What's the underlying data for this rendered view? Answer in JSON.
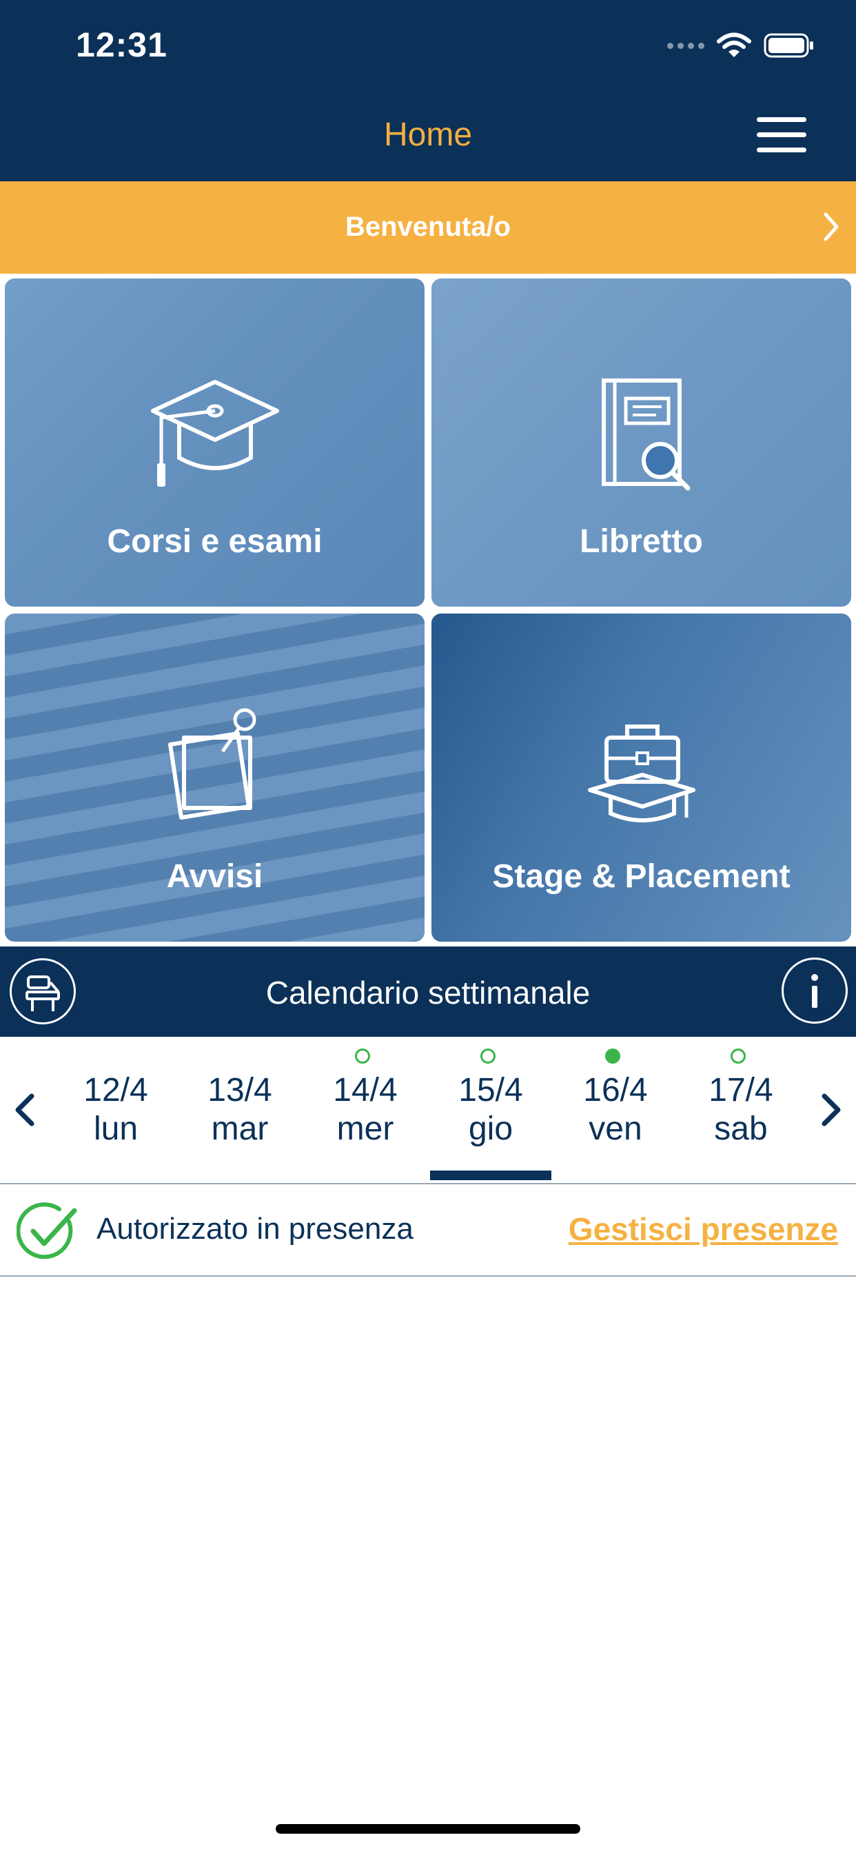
{
  "status_bar": {
    "time": "12:31"
  },
  "header": {
    "title": "Home",
    "menu_icon": "hamburger-menu-icon"
  },
  "welcome_banner": {
    "label": "Benvenuta/o",
    "icon": "chevron-right-icon"
  },
  "tiles": [
    {
      "label": "Corsi e esami",
      "icon": "graduation-cap-icon"
    },
    {
      "label": "Libretto",
      "icon": "booklet-search-icon"
    },
    {
      "label": "Avvisi",
      "icon": "notice-pin-icon"
    },
    {
      "label": "Stage & Placement",
      "icon": "briefcase-cap-icon"
    }
  ],
  "calendar": {
    "title": "Calendario settimanale",
    "left_icon": "school-desk-icon",
    "right_icon": "info-icon",
    "days": [
      {
        "date": "12/4",
        "name": "lun",
        "indicator": "none",
        "selected": false
      },
      {
        "date": "13/4",
        "name": "mar",
        "indicator": "none",
        "selected": false
      },
      {
        "date": "14/4",
        "name": "mer",
        "indicator": "outline",
        "selected": false
      },
      {
        "date": "15/4",
        "name": "gio",
        "indicator": "outline",
        "selected": true
      },
      {
        "date": "16/4",
        "name": "ven",
        "indicator": "filled",
        "selected": false
      },
      {
        "date": "17/4",
        "name": "sab",
        "indicator": "outline",
        "selected": false
      }
    ]
  },
  "presence": {
    "status_text": "Autorizzato in presenza",
    "status_icon": "check-circle-icon",
    "link_label": "Gestisci presenze"
  },
  "colors": {
    "navy": "#0b3158",
    "orange": "#f5b142",
    "green": "#3bb54a",
    "tile_overlay": "#2365aa"
  }
}
